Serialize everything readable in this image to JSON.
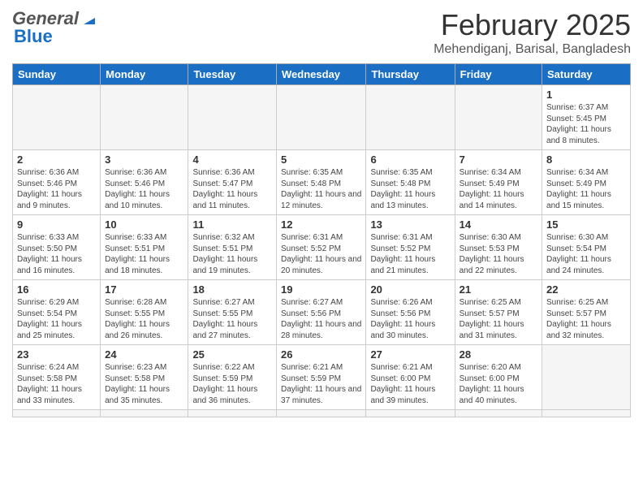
{
  "header": {
    "logo_general": "General",
    "logo_blue": "Blue",
    "month_title": "February 2025",
    "location": "Mehendiganj, Barisal, Bangladesh"
  },
  "weekdays": [
    "Sunday",
    "Monday",
    "Tuesday",
    "Wednesday",
    "Thursday",
    "Friday",
    "Saturday"
  ],
  "days": {
    "empty_start": 6,
    "cells": [
      {
        "num": "",
        "info": ""
      },
      {
        "num": "",
        "info": ""
      },
      {
        "num": "",
        "info": ""
      },
      {
        "num": "",
        "info": ""
      },
      {
        "num": "",
        "info": ""
      },
      {
        "num": "",
        "info": ""
      },
      {
        "num": "1",
        "info": "Sunrise: 6:37 AM\nSunset: 5:45 PM\nDaylight: 11 hours and 8 minutes."
      },
      {
        "num": "2",
        "info": "Sunrise: 6:36 AM\nSunset: 5:46 PM\nDaylight: 11 hours and 9 minutes."
      },
      {
        "num": "3",
        "info": "Sunrise: 6:36 AM\nSunset: 5:46 PM\nDaylight: 11 hours and 10 minutes."
      },
      {
        "num": "4",
        "info": "Sunrise: 6:36 AM\nSunset: 5:47 PM\nDaylight: 11 hours and 11 minutes."
      },
      {
        "num": "5",
        "info": "Sunrise: 6:35 AM\nSunset: 5:48 PM\nDaylight: 11 hours and 12 minutes."
      },
      {
        "num": "6",
        "info": "Sunrise: 6:35 AM\nSunset: 5:48 PM\nDaylight: 11 hours and 13 minutes."
      },
      {
        "num": "7",
        "info": "Sunrise: 6:34 AM\nSunset: 5:49 PM\nDaylight: 11 hours and 14 minutes."
      },
      {
        "num": "8",
        "info": "Sunrise: 6:34 AM\nSunset: 5:49 PM\nDaylight: 11 hours and 15 minutes."
      },
      {
        "num": "9",
        "info": "Sunrise: 6:33 AM\nSunset: 5:50 PM\nDaylight: 11 hours and 16 minutes."
      },
      {
        "num": "10",
        "info": "Sunrise: 6:33 AM\nSunset: 5:51 PM\nDaylight: 11 hours and 18 minutes."
      },
      {
        "num": "11",
        "info": "Sunrise: 6:32 AM\nSunset: 5:51 PM\nDaylight: 11 hours and 19 minutes."
      },
      {
        "num": "12",
        "info": "Sunrise: 6:31 AM\nSunset: 5:52 PM\nDaylight: 11 hours and 20 minutes."
      },
      {
        "num": "13",
        "info": "Sunrise: 6:31 AM\nSunset: 5:52 PM\nDaylight: 11 hours and 21 minutes."
      },
      {
        "num": "14",
        "info": "Sunrise: 6:30 AM\nSunset: 5:53 PM\nDaylight: 11 hours and 22 minutes."
      },
      {
        "num": "15",
        "info": "Sunrise: 6:30 AM\nSunset: 5:54 PM\nDaylight: 11 hours and 24 minutes."
      },
      {
        "num": "16",
        "info": "Sunrise: 6:29 AM\nSunset: 5:54 PM\nDaylight: 11 hours and 25 minutes."
      },
      {
        "num": "17",
        "info": "Sunrise: 6:28 AM\nSunset: 5:55 PM\nDaylight: 11 hours and 26 minutes."
      },
      {
        "num": "18",
        "info": "Sunrise: 6:27 AM\nSunset: 5:55 PM\nDaylight: 11 hours and 27 minutes."
      },
      {
        "num": "19",
        "info": "Sunrise: 6:27 AM\nSunset: 5:56 PM\nDaylight: 11 hours and 28 minutes."
      },
      {
        "num": "20",
        "info": "Sunrise: 6:26 AM\nSunset: 5:56 PM\nDaylight: 11 hours and 30 minutes."
      },
      {
        "num": "21",
        "info": "Sunrise: 6:25 AM\nSunset: 5:57 PM\nDaylight: 11 hours and 31 minutes."
      },
      {
        "num": "22",
        "info": "Sunrise: 6:25 AM\nSunset: 5:57 PM\nDaylight: 11 hours and 32 minutes."
      },
      {
        "num": "23",
        "info": "Sunrise: 6:24 AM\nSunset: 5:58 PM\nDaylight: 11 hours and 33 minutes."
      },
      {
        "num": "24",
        "info": "Sunrise: 6:23 AM\nSunset: 5:58 PM\nDaylight: 11 hours and 35 minutes."
      },
      {
        "num": "25",
        "info": "Sunrise: 6:22 AM\nSunset: 5:59 PM\nDaylight: 11 hours and 36 minutes."
      },
      {
        "num": "26",
        "info": "Sunrise: 6:21 AM\nSunset: 5:59 PM\nDaylight: 11 hours and 37 minutes."
      },
      {
        "num": "27",
        "info": "Sunrise: 6:21 AM\nSunset: 6:00 PM\nDaylight: 11 hours and 39 minutes."
      },
      {
        "num": "28",
        "info": "Sunrise: 6:20 AM\nSunset: 6:00 PM\nDaylight: 11 hours and 40 minutes."
      },
      {
        "num": "",
        "info": ""
      },
      {
        "num": "",
        "info": ""
      },
      {
        "num": "",
        "info": ""
      },
      {
        "num": "",
        "info": ""
      },
      {
        "num": "",
        "info": ""
      },
      {
        "num": "",
        "info": ""
      },
      {
        "num": "",
        "info": ""
      },
      {
        "num": "",
        "info": ""
      },
      {
        "num": "",
        "info": ""
      }
    ]
  }
}
